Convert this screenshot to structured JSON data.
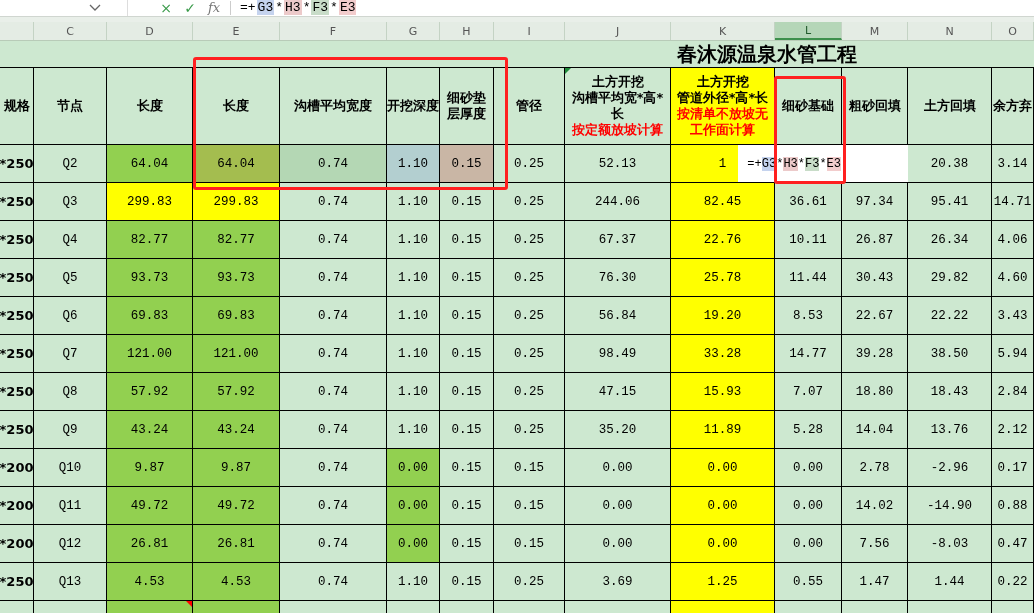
{
  "formula_bar": {
    "cancel": "×",
    "confirm": "✓",
    "function_label": "fx",
    "parts": [
      {
        "text": "=+"
      },
      {
        "text": "G3",
        "color": "#c5d3ee"
      },
      {
        "text": "*"
      },
      {
        "text": "H3",
        "color": "#eccaca"
      },
      {
        "text": "*"
      },
      {
        "text": "F3",
        "color": "#c8dcc8"
      },
      {
        "text": "*"
      },
      {
        "text": "E3",
        "color": "#f2cccc"
      }
    ]
  },
  "column_headers": [
    {
      "label": "C",
      "selected": false
    },
    {
      "label": "D",
      "selected": false
    },
    {
      "label": "E",
      "selected": false
    },
    {
      "label": "F",
      "selected": false
    },
    {
      "label": "G",
      "selected": false
    },
    {
      "label": "H",
      "selected": false
    },
    {
      "label": "I",
      "selected": false
    },
    {
      "label": "J",
      "selected": false
    },
    {
      "label": "K",
      "selected": false
    },
    {
      "label": "L",
      "selected": true
    },
    {
      "label": "M",
      "selected": false
    },
    {
      "label": "N",
      "selected": false
    },
    {
      "label": "O",
      "selected": false
    }
  ],
  "title": "春沐源温泉水管工程",
  "header_row": [
    {
      "lines": [
        "规格"
      ]
    },
    {
      "lines": [
        "节点"
      ]
    },
    {
      "lines": [
        "长度"
      ]
    },
    {
      "lines": [
        "长度"
      ]
    },
    {
      "lines": [
        "沟槽平均宽度"
      ]
    },
    {
      "lines": [
        "开挖深度"
      ]
    },
    {
      "lines": [
        "细砂垫",
        "层厚度"
      ]
    },
    {
      "lines": [
        "管径"
      ]
    },
    {
      "lines": [
        "土方开挖",
        "沟槽平均宽*高*",
        "长"
      ],
      "notes": [
        "按定额放坡计算"
      ],
      "error_flag": true
    },
    {
      "lines": [
        "土方开挖",
        "管道外径*高*长"
      ],
      "notes": [
        "按清单不放坡无",
        "工作面计算"
      ],
      "color": "#ffff00"
    },
    {
      "lines": [
        "细砂基础"
      ]
    },
    {
      "lines": [
        "粗砂回填"
      ]
    },
    {
      "lines": [
        "土方回填"
      ]
    },
    {
      "lines": [
        "余方弃"
      ]
    }
  ],
  "rows": [
    {
      "cells": [
        "*250",
        "Q2",
        {
          "text": "64.04",
          "color": "#92d050"
        },
        {
          "text": "64.04",
          "color": "#a4bd4f"
        },
        {
          "text": "0.74",
          "color": "#b4d7b4"
        },
        {
          "text": "1.10",
          "color": "#b3cfd0"
        },
        {
          "text": "0.15",
          "color": "#c9b6a5"
        },
        "0.25",
        "52.13",
        {
          "text": "1",
          "color": "#ffff00"
        },
        {
          "editing": true,
          "parts": [
            {
              "text": "=+"
            },
            {
              "text": "G3",
              "color": "#c5d3ee"
            },
            {
              "text": "*"
            },
            {
              "text": "H3",
              "color": "#eccaca"
            },
            {
              "text": "*"
            },
            {
              "text": "F3",
              "color": "#c8dcc8"
            },
            {
              "text": "*"
            },
            {
              "text": "E3",
              "color": "#f2cccc"
            }
          ]
        },
        null,
        "20.38",
        "3.14"
      ]
    },
    {
      "cells": [
        "*250",
        "Q3",
        {
          "text": "299.83",
          "color": "#ffff00"
        },
        {
          "text": "299.83",
          "color": "#ffff00"
        },
        "0.74",
        "1.10",
        "0.15",
        "0.25",
        "244.06",
        {
          "text": "82.45",
          "color": "#ffff00"
        },
        "36.61",
        "97.34",
        "95.41",
        "14.71"
      ]
    },
    {
      "cells": [
        "*250",
        "Q4",
        {
          "text": "82.77",
          "color": "#92d050"
        },
        {
          "text": "82.77",
          "color": "#92d050"
        },
        "0.74",
        "1.10",
        "0.15",
        "0.25",
        "67.37",
        {
          "text": "22.76",
          "color": "#ffff00"
        },
        "10.11",
        "26.87",
        "26.34",
        "4.06"
      ]
    },
    {
      "cells": [
        "*250",
        "Q5",
        {
          "text": "93.73",
          "color": "#92d050"
        },
        {
          "text": "93.73",
          "color": "#92d050"
        },
        "0.74",
        "1.10",
        "0.15",
        "0.25",
        "76.30",
        {
          "text": "25.78",
          "color": "#ffff00"
        },
        "11.44",
        "30.43",
        "29.82",
        "4.60"
      ]
    },
    {
      "cells": [
        "*250",
        "Q6",
        {
          "text": "69.83",
          "color": "#92d050"
        },
        {
          "text": "69.83",
          "color": "#92d050"
        },
        "0.74",
        "1.10",
        "0.15",
        "0.25",
        "56.84",
        {
          "text": "19.20",
          "color": "#ffff00"
        },
        "8.53",
        "22.67",
        "22.22",
        "3.43"
      ]
    },
    {
      "cells": [
        "*250",
        "Q7",
        {
          "text": "121.00",
          "color": "#92d050"
        },
        {
          "text": "121.00",
          "color": "#92d050"
        },
        "0.74",
        "1.10",
        "0.15",
        "0.25",
        "98.49",
        {
          "text": "33.28",
          "color": "#ffff00"
        },
        "14.77",
        "39.28",
        "38.50",
        "5.94"
      ]
    },
    {
      "cells": [
        "*250",
        "Q8",
        {
          "text": "57.92",
          "color": "#92d050"
        },
        {
          "text": "57.92",
          "color": "#92d050"
        },
        "0.74",
        "1.10",
        "0.15",
        "0.25",
        "47.15",
        {
          "text": "15.93",
          "color": "#ffff00"
        },
        "7.07",
        "18.80",
        "18.43",
        "2.84"
      ]
    },
    {
      "cells": [
        "*250",
        "Q9",
        {
          "text": "43.24",
          "color": "#92d050"
        },
        {
          "text": "43.24",
          "color": "#92d050"
        },
        "0.74",
        "1.10",
        "0.15",
        "0.25",
        "35.20",
        {
          "text": "11.89",
          "color": "#ffff00"
        },
        "5.28",
        "14.04",
        "13.76",
        "2.12"
      ]
    },
    {
      "cells": [
        "*200",
        "Q10",
        {
          "text": "9.87",
          "color": "#92d050"
        },
        {
          "text": "9.87",
          "color": "#92d050"
        },
        "0.74",
        {
          "text": "0.00",
          "color": "#92d050"
        },
        "0.15",
        "0.15",
        "0.00",
        {
          "text": "0.00",
          "color": "#ffff00"
        },
        "0.00",
        "2.78",
        "-2.96",
        "0.17"
      ]
    },
    {
      "cells": [
        "*200",
        "Q11",
        {
          "text": "49.72",
          "color": "#92d050"
        },
        {
          "text": "49.72",
          "color": "#92d050"
        },
        "0.74",
        {
          "text": "0.00",
          "color": "#92d050"
        },
        "0.15",
        "0.15",
        "0.00",
        {
          "text": "0.00",
          "color": "#ffff00"
        },
        "0.00",
        "14.02",
        "-14.90",
        "0.88"
      ]
    },
    {
      "cells": [
        "*200",
        "Q12",
        {
          "text": "26.81",
          "color": "#92d050"
        },
        {
          "text": "26.81",
          "color": "#92d050"
        },
        "0.74",
        {
          "text": "0.00",
          "color": "#92d050"
        },
        "0.15",
        "0.15",
        "0.00",
        {
          "text": "0.00",
          "color": "#ffff00"
        },
        "0.00",
        "7.56",
        "-8.03",
        "0.47"
      ]
    },
    {
      "cells": [
        "*250",
        "Q13",
        {
          "text": "4.53",
          "color": "#92d050"
        },
        {
          "text": "4.53",
          "color": "#92d050"
        },
        "0.74",
        "1.10",
        "0.15",
        "0.25",
        "3.69",
        {
          "text": "1.25",
          "color": "#ffff00"
        },
        "0.55",
        "1.47",
        "1.44",
        "0.22"
      ]
    },
    {
      "cells": [
        null,
        null,
        {
          "color": "#92d050",
          "comment": true
        },
        {
          "color": "#92d050"
        },
        null,
        null,
        null,
        null,
        null,
        {
          "color": "#ffff00"
        },
        null,
        null,
        null,
        null
      ]
    }
  ],
  "annotations": [
    {
      "kind": "rectangle"
    },
    {
      "kind": "rectangle"
    }
  ]
}
